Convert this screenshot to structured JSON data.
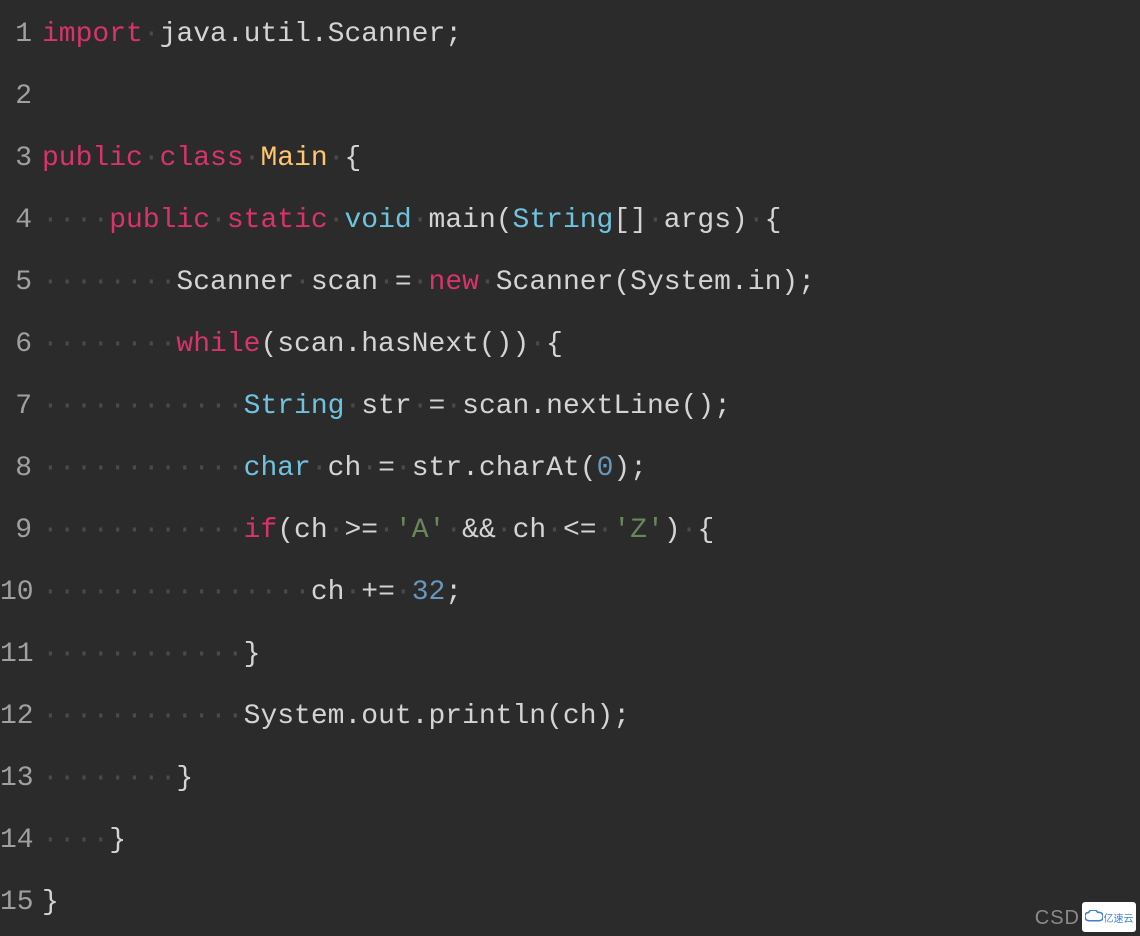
{
  "lines": [
    {
      "num": "1",
      "tokens": [
        [
          "kw",
          "import"
        ],
        [
          "ws",
          "·"
        ],
        [
          "",
          "java.util.Scanner;"
        ]
      ]
    },
    {
      "num": "2",
      "tokens": []
    },
    {
      "num": "3",
      "tokens": [
        [
          "kw",
          "public"
        ],
        [
          "ws",
          "·"
        ],
        [
          "kw",
          "class"
        ],
        [
          "ws",
          "·"
        ],
        [
          "cls",
          "Main"
        ],
        [
          "ws",
          "·"
        ],
        [
          "",
          "{"
        ]
      ]
    },
    {
      "num": "4",
      "tokens": [
        [
          "ws",
          "····"
        ],
        [
          "kw",
          "public"
        ],
        [
          "ws",
          "·"
        ],
        [
          "kw",
          "static"
        ],
        [
          "ws",
          "·"
        ],
        [
          "typ",
          "void"
        ],
        [
          "ws",
          "·"
        ],
        [
          "",
          "main("
        ],
        [
          "typ",
          "String"
        ],
        [
          "",
          "[]"
        ],
        [
          "ws",
          "·"
        ],
        [
          "",
          "args)"
        ],
        [
          "ws",
          "·"
        ],
        [
          "",
          "{"
        ]
      ]
    },
    {
      "num": "5",
      "tokens": [
        [
          "ws",
          "········"
        ],
        [
          "",
          "Scanner"
        ],
        [
          "ws",
          "·"
        ],
        [
          "",
          "scan"
        ],
        [
          "ws",
          "·"
        ],
        [
          "",
          "="
        ],
        [
          "ws",
          "·"
        ],
        [
          "kw",
          "new"
        ],
        [
          "ws",
          "·"
        ],
        [
          "",
          "Scanner(System.in);"
        ]
      ]
    },
    {
      "num": "6",
      "tokens": [
        [
          "ws",
          "········"
        ],
        [
          "kw",
          "while"
        ],
        [
          "",
          "(scan.hasNext())"
        ],
        [
          "ws",
          "·"
        ],
        [
          "",
          "{"
        ]
      ]
    },
    {
      "num": "7",
      "tokens": [
        [
          "ws",
          "············"
        ],
        [
          "typ",
          "String"
        ],
        [
          "ws",
          "·"
        ],
        [
          "",
          "str"
        ],
        [
          "ws",
          "·"
        ],
        [
          "",
          "="
        ],
        [
          "ws",
          "·"
        ],
        [
          "",
          "scan.nextLine();"
        ]
      ]
    },
    {
      "num": "8",
      "tokens": [
        [
          "ws",
          "············"
        ],
        [
          "typ",
          "char"
        ],
        [
          "ws",
          "·"
        ],
        [
          "",
          "ch"
        ],
        [
          "ws",
          "·"
        ],
        [
          "",
          "="
        ],
        [
          "ws",
          "·"
        ],
        [
          "",
          "str.charAt("
        ],
        [
          "num",
          "0"
        ],
        [
          "",
          ");"
        ]
      ]
    },
    {
      "num": "9",
      "tokens": [
        [
          "ws",
          "············"
        ],
        [
          "kw",
          "if"
        ],
        [
          "",
          "(ch"
        ],
        [
          "ws",
          "·"
        ],
        [
          "",
          ">="
        ],
        [
          "ws",
          "·"
        ],
        [
          "str",
          "'A'"
        ],
        [
          "ws",
          "·"
        ],
        [
          "",
          "&&"
        ],
        [
          "ws",
          "·"
        ],
        [
          "",
          "ch"
        ],
        [
          "ws",
          "·"
        ],
        [
          "",
          "<="
        ],
        [
          "ws",
          "·"
        ],
        [
          "str",
          "'Z'"
        ],
        [
          "",
          ")"
        ],
        [
          "ws",
          "·"
        ],
        [
          "",
          "{"
        ]
      ]
    },
    {
      "num": "10",
      "tokens": [
        [
          "ws",
          "················"
        ],
        [
          "",
          "ch"
        ],
        [
          "ws",
          "·"
        ],
        [
          "",
          "+="
        ],
        [
          "ws",
          "·"
        ],
        [
          "num",
          "32"
        ],
        [
          "",
          ";"
        ]
      ]
    },
    {
      "num": "11",
      "tokens": [
        [
          "ws",
          "············"
        ],
        [
          "",
          "}"
        ]
      ]
    },
    {
      "num": "12",
      "tokens": [
        [
          "ws",
          "············"
        ],
        [
          "",
          "System.out.println(ch);"
        ]
      ]
    },
    {
      "num": "13",
      "tokens": [
        [
          "ws",
          "········"
        ],
        [
          "",
          "}"
        ]
      ]
    },
    {
      "num": "14",
      "tokens": [
        [
          "ws",
          "····"
        ],
        [
          "",
          "}"
        ]
      ]
    },
    {
      "num": "15",
      "tokens": [
        [
          "",
          "}"
        ]
      ]
    }
  ],
  "watermark_csd": "CSD",
  "watermark_badge": "亿速云"
}
